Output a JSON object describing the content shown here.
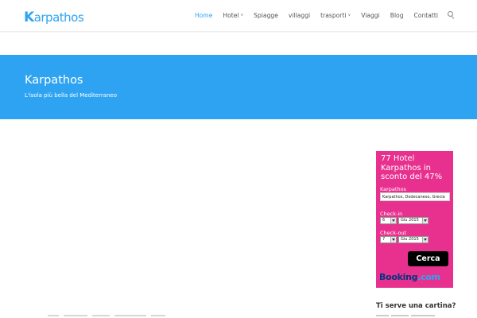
{
  "header": {
    "logo_cap": "K",
    "logo_rest": "arpathos",
    "nav": [
      {
        "label": "Home",
        "active": true,
        "has_caret": false
      },
      {
        "label": "Hotel",
        "active": false,
        "has_caret": true
      },
      {
        "label": "Spiagge",
        "active": false,
        "has_caret": false
      },
      {
        "label": "villaggi",
        "active": false,
        "has_caret": false
      },
      {
        "label": "trasporti",
        "active": false,
        "has_caret": true
      },
      {
        "label": "Viaggi",
        "active": false,
        "has_caret": false
      },
      {
        "label": "Blog",
        "active": false,
        "has_caret": false
      },
      {
        "label": "Contatti",
        "active": false,
        "has_caret": false
      }
    ],
    "caret_glyph": "∨",
    "search_icon": "search-icon"
  },
  "hero": {
    "title": "Karpathos",
    "subtitle": "L'isola più bella del Mediterraneo"
  },
  "widget": {
    "title": "77 Hotel Karpathos in sconto del 47%",
    "destination_label": "Karpathos",
    "destination_value": "Karpathos, Dodecaneso, Grecia",
    "checkin_label": "Check-in",
    "checkin_day": "6",
    "checkin_month": "Giu 2015",
    "checkout_label": "Check-out",
    "checkout_day": "7",
    "checkout_month": "Giu 2015",
    "search_button": "Cerca",
    "brand_main": "Booking",
    "brand_suffix": ".com"
  },
  "sidebar": {
    "heading": "Ti serve una cartina?"
  },
  "colors": {
    "accent": "#2ea3f2",
    "widget_bg": "#e8318f",
    "booking_blue": "#003580"
  }
}
